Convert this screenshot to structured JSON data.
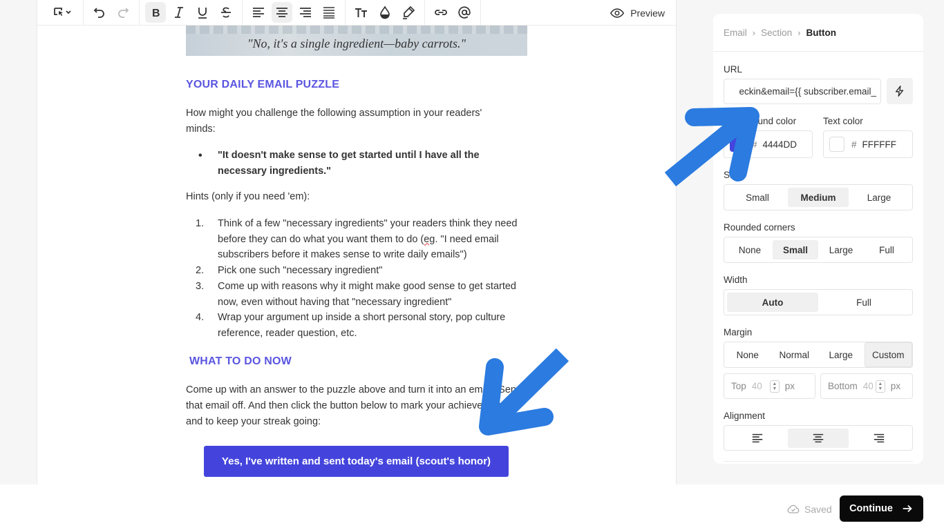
{
  "toolbar": {
    "preview_label": "Preview",
    "buttons": [
      "select-icon",
      "undo-icon",
      "redo-icon",
      "bold-icon",
      "italic-icon",
      "underline-icon",
      "strikethrough-icon",
      "align-left-icon",
      "align-center-icon",
      "align-right-icon",
      "align-justify-icon",
      "text-size-icon",
      "color-drop-icon",
      "highlighter-icon",
      "link-icon",
      "mention-icon"
    ]
  },
  "doc": {
    "image_caption": "\"No, it's a single ingredient—baby carrots.\"",
    "puzzle_heading": "YOUR DAILY EMAIL PUZZLE",
    "puzzle_intro": "How might you challenge the following assumption in your readers' minds:",
    "assumption": "\"It doesn't make sense to get started until I have all the necessary ingredients.\"",
    "hints_intro": "Hints (only if you need 'em):",
    "hints": [
      {
        "num": "1.",
        "pre": "Think of a few \"necessary ingredients\" your readers think they need before they can do what you want them to do (",
        "squiggle": "eg",
        "post": ". \"I need email subscribers before it makes sense to write daily emails\")"
      },
      {
        "num": "2.",
        "text": "Pick one such \"necessary ingredient\""
      },
      {
        "num": "3.",
        "text": "Come up with reasons why it might make good sense to get started now, even without having that \"necessary ingredient\""
      },
      {
        "num": "4.",
        "text": "Wrap your argument up inside a short personal story, pop culture reference, reader question, etc."
      }
    ],
    "todo_heading": "WHAT TO DO NOW",
    "todo_para": "Come up with an answer to the puzzle above and turn it into an email. Send that email off. And then click the button below to mark your achievement, and to keep your streak going:",
    "cta_label": "Yes, I've written and sent today's email (scout's honor)"
  },
  "panel": {
    "breadcrumb": [
      "Email",
      "Section",
      "Button"
    ],
    "url_label": "URL",
    "url_value": "eckin&email={{ subscriber.email_",
    "bg_color_label": "Background color",
    "bg_color_value": "4444DD",
    "bg_color_hex": "#4444DD",
    "text_color_label": "Text color",
    "text_color_value": "FFFFFF",
    "text_color_hex": "#FFFFFF",
    "size_label": "Size",
    "size_options": [
      "Small",
      "Medium",
      "Large"
    ],
    "size_selected": "Medium",
    "corners_label": "Rounded corners",
    "corners_options": [
      "None",
      "Small",
      "Large",
      "Full"
    ],
    "corners_selected": "Small",
    "width_label": "Width",
    "width_options": [
      "Auto",
      "Full"
    ],
    "width_selected": "Auto",
    "margin_label": "Margin",
    "margin_options": [
      "None",
      "Normal",
      "Large",
      "Custom"
    ],
    "margin_selected": "Custom",
    "margin_top_label": "Top",
    "margin_top_value": "40",
    "margin_bottom_label": "Bottom",
    "margin_bottom_value": "40",
    "margin_unit": "px",
    "alignment_label": "Alignment",
    "alignment_options": [
      "align-left-icon",
      "align-center-icon",
      "align-right-icon"
    ],
    "alignment_selected": "align-center-icon"
  },
  "footer": {
    "saved_label": "Saved",
    "continue_label": "Continue"
  },
  "colors": {
    "accent": "#4444DD",
    "heading": "#5A55E0",
    "annotation_arrow": "#2B7BE0"
  }
}
